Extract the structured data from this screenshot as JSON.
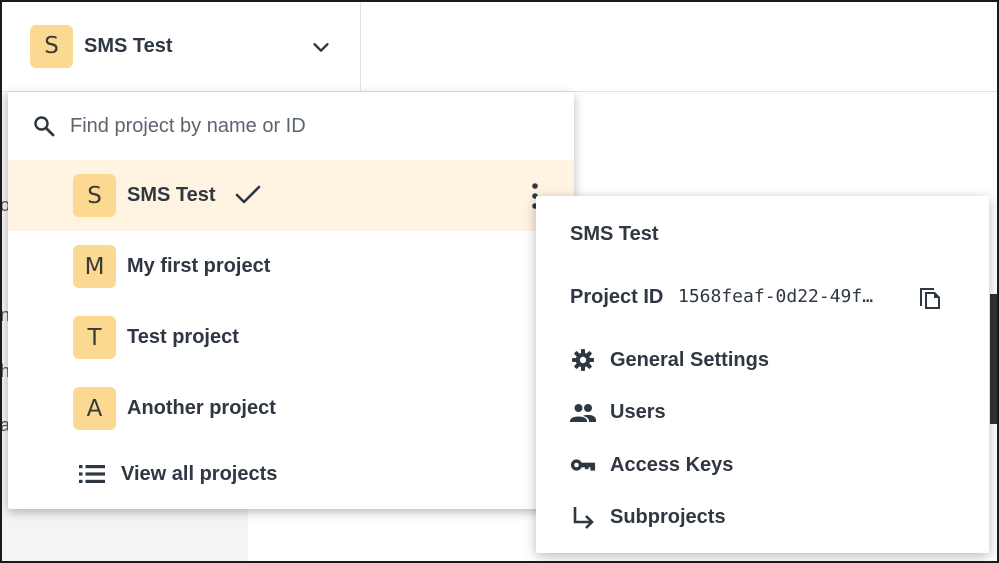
{
  "header": {
    "current_project": {
      "initial": "S",
      "name": "SMS Test"
    }
  },
  "dropdown": {
    "search": {
      "placeholder": "Find project by name or ID"
    },
    "projects": [
      {
        "initial": "S",
        "name": "SMS Test",
        "selected": true
      },
      {
        "initial": "M",
        "name": "My first project"
      },
      {
        "initial": "T",
        "name": "Test project"
      },
      {
        "initial": "A",
        "name": "Another project"
      }
    ],
    "view_all_label": "View all projects"
  },
  "context_menu": {
    "title": "SMS Test",
    "project_id_label": "Project ID",
    "project_id_value": "1568feaf-0d22-49f…",
    "items": [
      {
        "label": "General Settings",
        "icon": "gear-icon"
      },
      {
        "label": "Users",
        "icon": "users-icon"
      },
      {
        "label": "Access Keys",
        "icon": "key-icon"
      },
      {
        "label": "Subprojects",
        "icon": "subdirectory-arrow-icon"
      }
    ]
  },
  "background": {
    "fragments": [
      "o",
      "n",
      "h",
      "a"
    ]
  },
  "colors": {
    "avatar_bg": "#fbd991",
    "selected_row_bg": "#fff3e1",
    "text": "#2f3742"
  }
}
